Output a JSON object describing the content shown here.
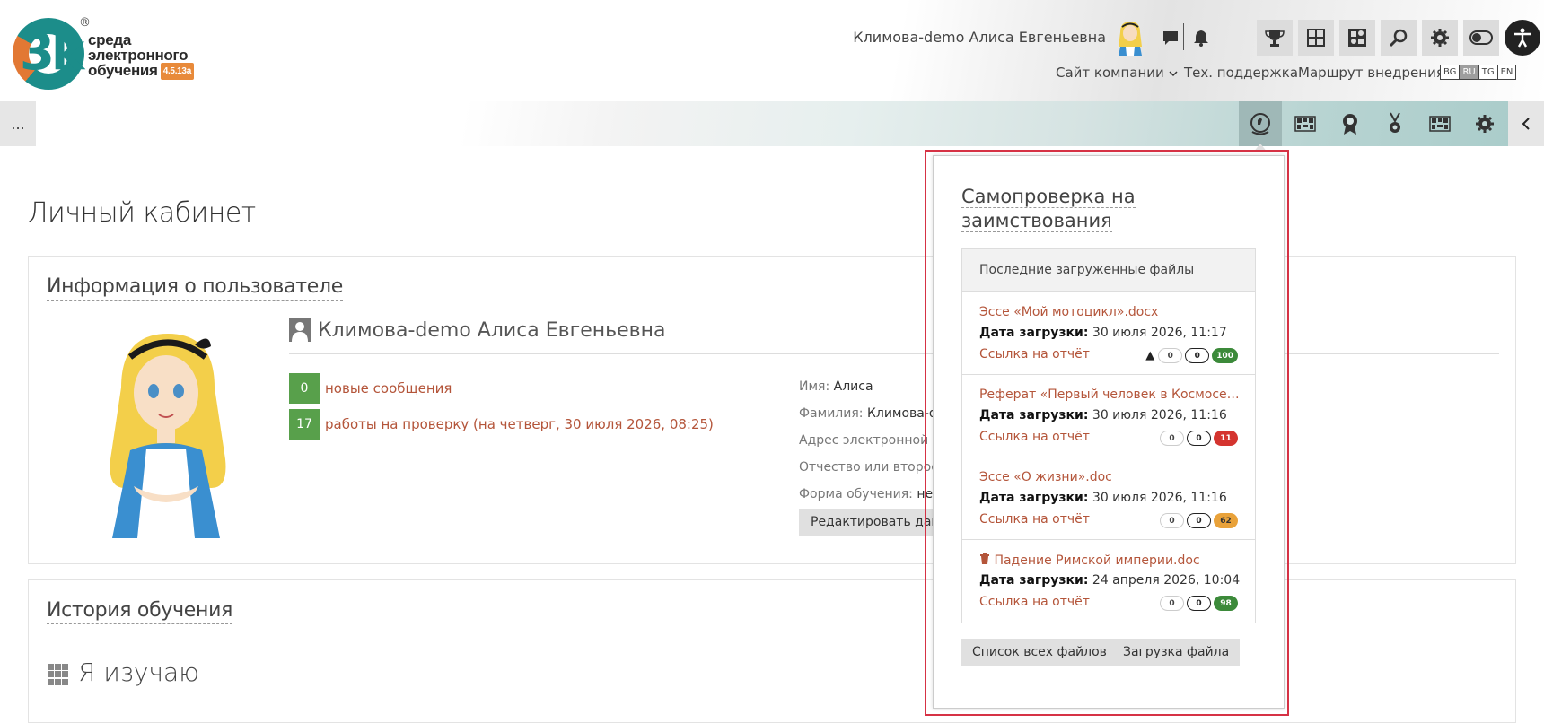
{
  "header": {
    "logo": {
      "line1": "среда",
      "line2": "электронного",
      "line3": "обучения",
      "version": "4.5.13a",
      "mark": "3k",
      "reg": "®"
    },
    "user_name": "Климова-demo Алиса Евгеньевна",
    "icons": [
      "chat-icon",
      "bell-icon",
      "trophy-icon",
      "dashboard-icon",
      "puzzle-icon",
      "search-icon",
      "gear-icon",
      "toggle-icon",
      "accessibility-icon"
    ],
    "nav": {
      "company": "Сайт компании",
      "support": "Тех. поддержка",
      "route": "Маршрут внедрения"
    },
    "languages": [
      {
        "code": "BG",
        "active": false
      },
      {
        "code": "RU",
        "active": true
      },
      {
        "code": "TG",
        "active": false
      },
      {
        "code": "EN",
        "active": false
      }
    ]
  },
  "toolbar": {
    "menu_label": "...",
    "icons": [
      "plagiarism-check-icon",
      "qr-table-icon",
      "award-icon",
      "medal-icon",
      "qr-table-icon-2",
      "settings-icon"
    ],
    "active_icon": "plagiarism-check-icon"
  },
  "main": {
    "page_title": "Личный кабинет",
    "user_info": {
      "section_title": "Информация о пользователе",
      "full_name": "Климова-demo Алиса Евгеньевна",
      "new_messages_count": "0",
      "new_messages_label": "новые сообщения",
      "review_count": "17",
      "review_label": "работы на проверку (на четверг, 30 июля 2026, 08:25)",
      "first_name_label": "Имя:",
      "first_name": "Алиса",
      "last_name_label": "Фамилия:",
      "last_name": "Климова-de",
      "email_label": "Адрес электронной п",
      "patronymic_label": "Отчество или второе",
      "form_label": "Форма обучения:",
      "form_value": "не в",
      "edit_button": "Редактировать данн"
    },
    "history": {
      "section_title": "История обучения",
      "learning_title": "Я изучаю"
    }
  },
  "popup": {
    "title_line1": "Самопроверка на",
    "title_line2": "заимствования",
    "files_header": "Последние загруженные файлы",
    "date_label": "Дата загрузки:",
    "report_label": "Ссылка на отчёт",
    "files": [
      {
        "name": "Эссе «Мой мотоцикл».docx",
        "date": "30 июля 2026, 11:17",
        "warning": true,
        "deleted": false,
        "b1": "0",
        "b2": "0",
        "score": "100",
        "score_color": "#3c8a3a"
      },
      {
        "name": "Реферат «Первый человек в Космосе».docx",
        "date": "30 июля 2026, 11:16",
        "warning": false,
        "deleted": false,
        "b1": "0",
        "b2": "0",
        "score": "11",
        "score_color": "#d4342f"
      },
      {
        "name": "Эссе «О жизни».doc",
        "date": "30 июля 2026, 11:16",
        "warning": false,
        "deleted": false,
        "b1": "0",
        "b2": "0",
        "score": "62",
        "score_color": "#e9a23a"
      },
      {
        "name": "Падение Римской империи.doc",
        "date": "24 апреля 2026, 10:04",
        "warning": false,
        "deleted": true,
        "b1": "0",
        "b2": "0",
        "score": "98",
        "score_color": "#3c8a3a"
      }
    ],
    "list_button": "Список всех файлов",
    "upload_button": "Загрузка файла"
  },
  "colors": {
    "accent": "#b4553a",
    "highlight": "#d63245",
    "stat_green": "#58a04b"
  }
}
